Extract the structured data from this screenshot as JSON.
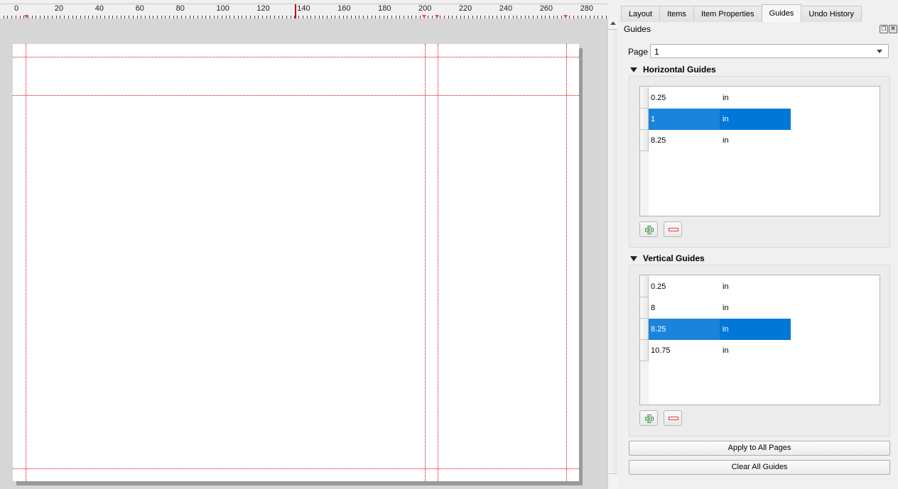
{
  "ruler": {
    "labels": [
      "0",
      "20",
      "40",
      "60",
      "80",
      "100",
      "120",
      "140",
      "160",
      "180",
      "200",
      "220",
      "240",
      "260",
      "280"
    ],
    "unit_hint": "mm",
    "guide_markers_mm": [
      6.35,
      203.2,
      209.55,
      273.05
    ],
    "cursor_mm": 140
  },
  "canvas": {
    "page_size_in": [
      11,
      8.5
    ],
    "horizontal_guides_in": [
      0.25,
      1,
      8.25
    ],
    "vertical_guides_in": [
      0.25,
      8,
      8.25,
      10.75
    ],
    "guide_color": "#e00000"
  },
  "dock": {
    "tabs": [
      {
        "label": "Layout",
        "active": false
      },
      {
        "label": "Items",
        "active": false
      },
      {
        "label": "Item Properties",
        "active": false
      },
      {
        "label": "Guides",
        "active": true
      },
      {
        "label": "Undo History",
        "active": false
      }
    ],
    "title": "Guides",
    "float_icon": "float-icon",
    "close_icon": "close-icon",
    "page_label": "Page",
    "page_value": "1",
    "horizontal": {
      "header": "Horizontal Guides",
      "rows": [
        {
          "value": "0.25",
          "unit": "in",
          "selected": false
        },
        {
          "value": "1",
          "unit": "in",
          "selected": true
        },
        {
          "value": "8.25",
          "unit": "in",
          "selected": false
        }
      ]
    },
    "vertical": {
      "header": "Vertical Guides",
      "rows": [
        {
          "value": "0.25",
          "unit": "in",
          "selected": false
        },
        {
          "value": "8",
          "unit": "in",
          "selected": false
        },
        {
          "value": "8.25",
          "unit": "in",
          "selected": true
        },
        {
          "value": "10.75",
          "unit": "in",
          "selected": false
        }
      ]
    },
    "apply_all_label": "Apply to All Pages",
    "clear_all_label": "Clear All Guides",
    "accent_color": "#0078d7"
  }
}
